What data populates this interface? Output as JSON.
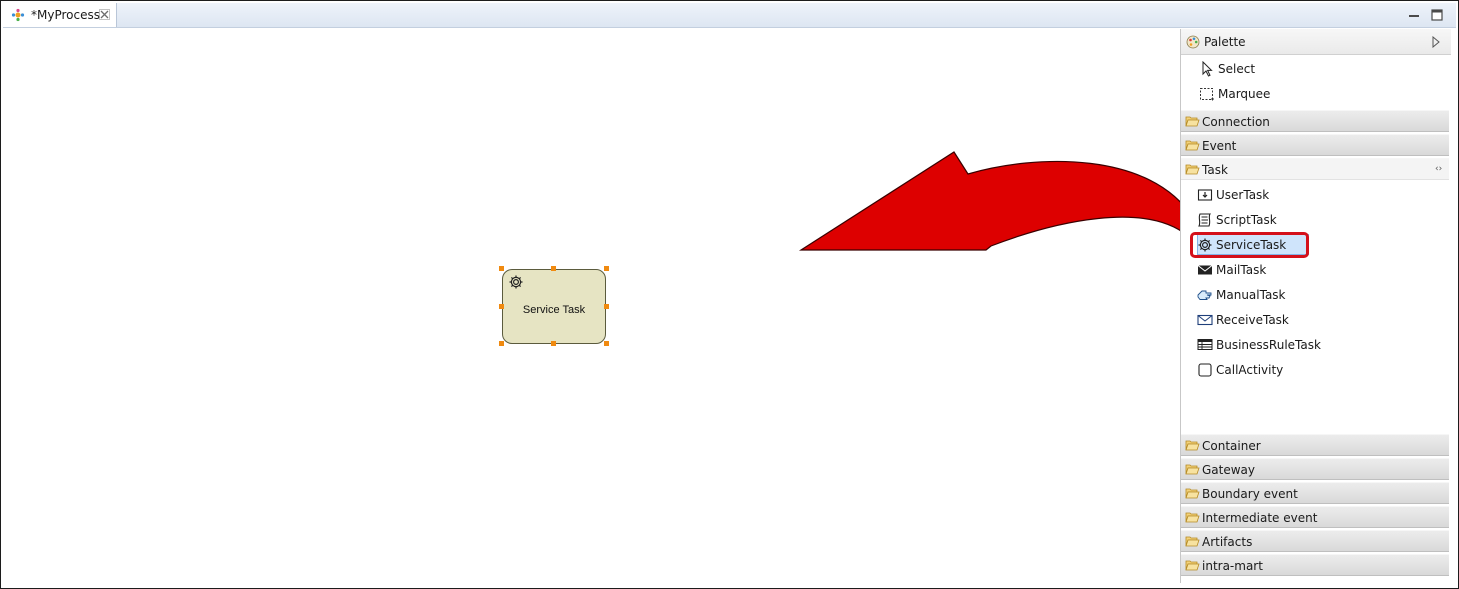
{
  "tab": {
    "title": "*MyProcess",
    "icon": "process-diagram-icon",
    "close_icon": "close-icon"
  },
  "window_controls": {
    "minimize_icon": "minimize-icon",
    "maximize_icon": "maximize-icon"
  },
  "canvas": {
    "task_label": "Service Task",
    "task_icon": "gear-icon",
    "task_fill": "#e6e4c3",
    "selection_handle_color": "#f08a10"
  },
  "annotation": {
    "arrow_color": "#dd0000",
    "highlight_color": "#d4101a"
  },
  "palette": {
    "title": "Palette",
    "tools": [
      {
        "label": "Select",
        "icon": "pointer-icon"
      },
      {
        "label": "Marquee",
        "icon": "marquee-icon"
      }
    ],
    "drawers": [
      {
        "label": "Connection",
        "open": false
      },
      {
        "label": "Event",
        "open": false
      },
      {
        "label": "Task",
        "open": true
      },
      {
        "label": "Container",
        "open": false
      },
      {
        "label": "Gateway",
        "open": false
      },
      {
        "label": "Boundary event",
        "open": false
      },
      {
        "label": "Intermediate event",
        "open": false
      },
      {
        "label": "Artifacts",
        "open": false
      },
      {
        "label": "intra-mart",
        "open": false
      }
    ],
    "task_entries": [
      {
        "label": "UserTask",
        "icon": "user-task-icon"
      },
      {
        "label": "ScriptTask",
        "icon": "script-task-icon"
      },
      {
        "label": "ServiceTask",
        "icon": "gear-icon",
        "selected": true
      },
      {
        "label": "MailTask",
        "icon": "mail-task-icon"
      },
      {
        "label": "ManualTask",
        "icon": "manual-task-icon"
      },
      {
        "label": "ReceiveTask",
        "icon": "receive-task-icon"
      },
      {
        "label": "BusinessRuleTask",
        "icon": "business-rule-task-icon"
      },
      {
        "label": "CallActivity",
        "icon": "call-activity-icon"
      }
    ]
  }
}
